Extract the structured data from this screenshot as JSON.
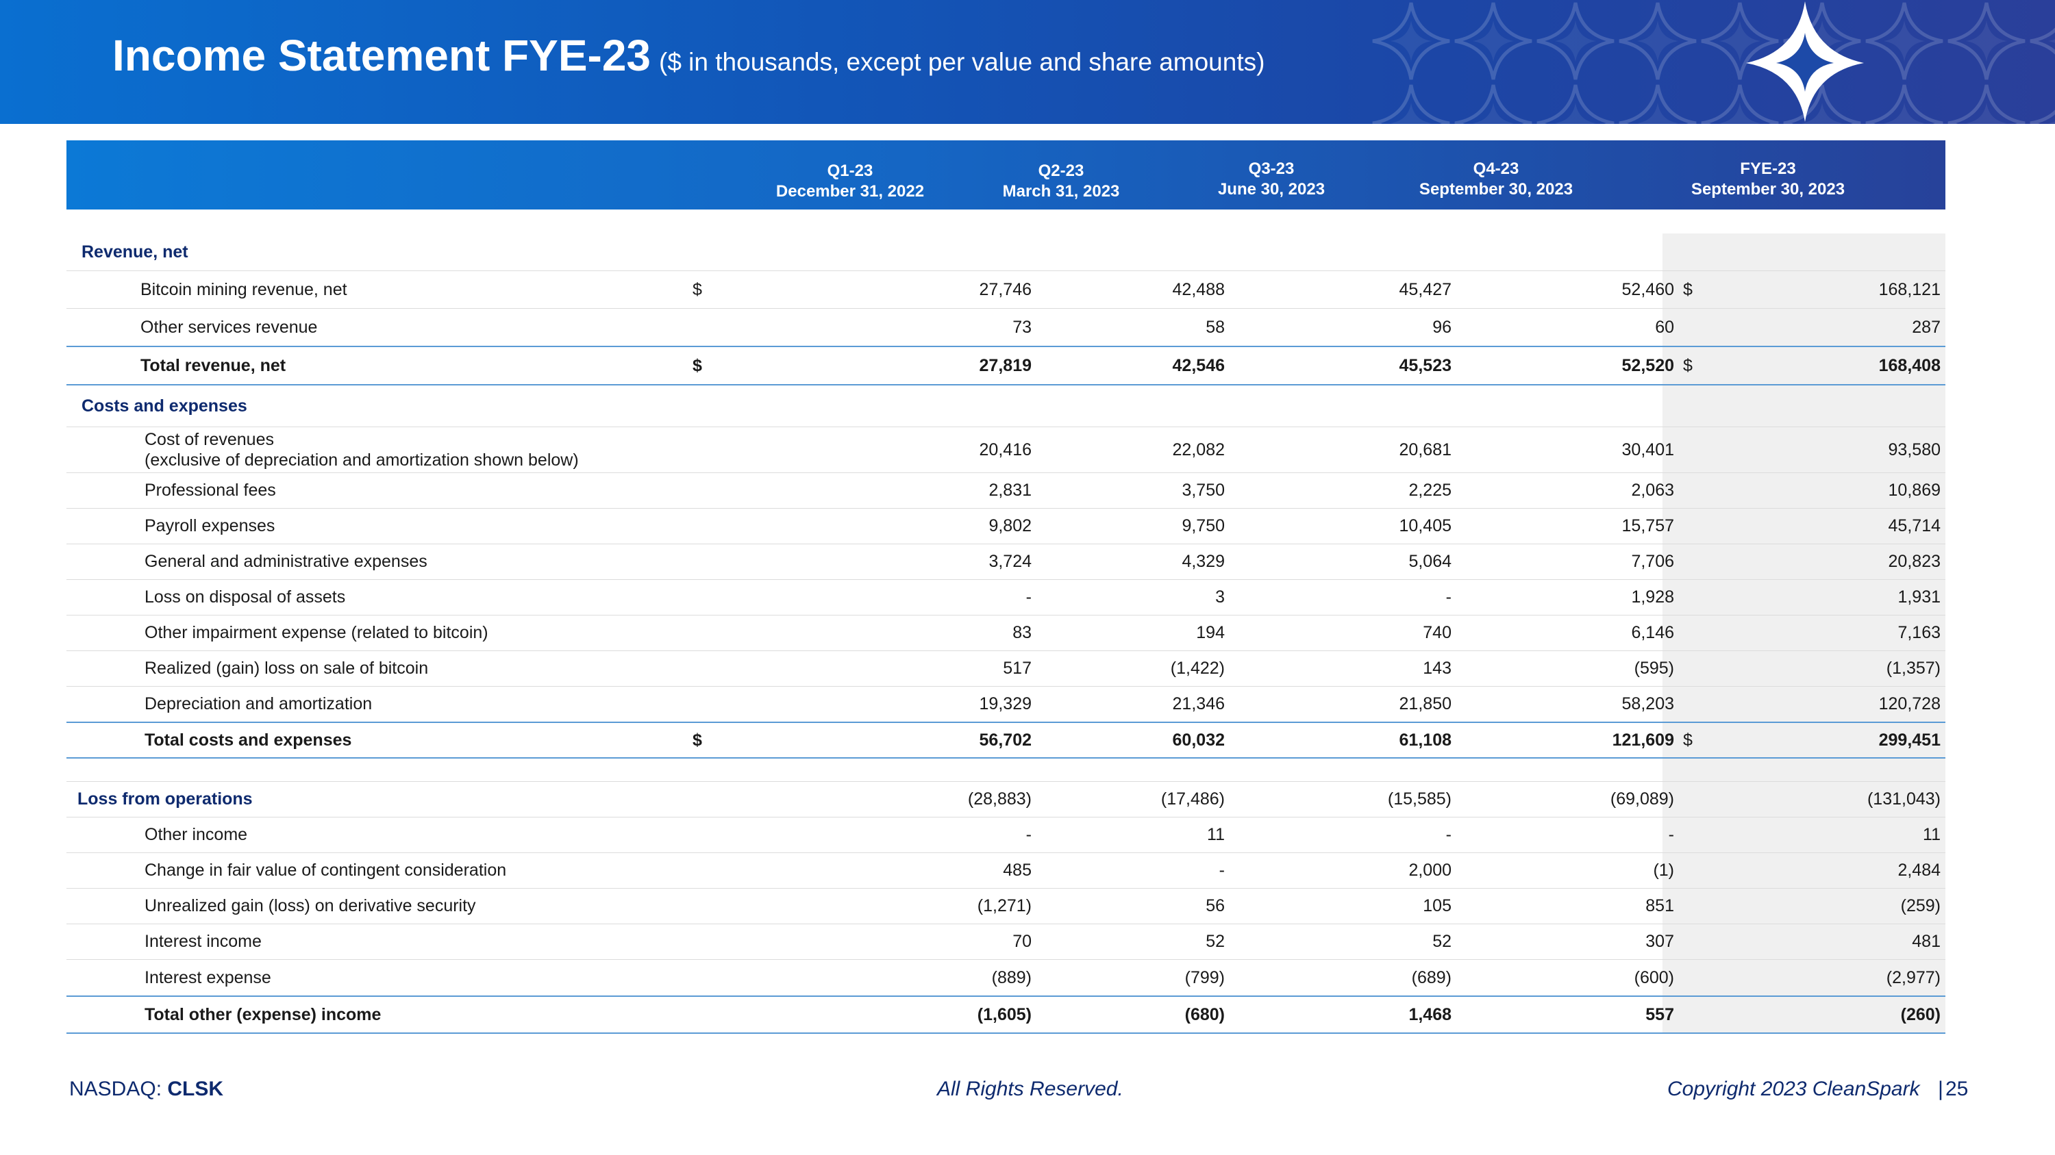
{
  "header": {
    "title": "Income Statement FYE-23",
    "subtitle": "($ in thousands, except per value and share amounts)",
    "logo_icon": "cleanspark-star-logo-icon"
  },
  "columns": [
    {
      "period": "Q1-23",
      "date": "December 31, 2022"
    },
    {
      "period": "Q2-23",
      "date": "March 31, 2023"
    },
    {
      "period": "Q3-23",
      "date": "June 30, 2023"
    },
    {
      "period": "Q4-23",
      "date": "September 30, 2023"
    },
    {
      "period": "FYE-23",
      "date": "September 30, 2023"
    }
  ],
  "rows": {
    "revenue_header": "Revenue, net",
    "bitcoin": {
      "label": "Bitcoin mining revenue, net",
      "d1": "$",
      "d5": "$",
      "v": [
        "27,746",
        "42,488",
        "45,427",
        "52,460",
        "168,121"
      ]
    },
    "other_services": {
      "label": "Other services revenue",
      "v": [
        "73",
        "58",
        "96",
        "60",
        "287"
      ]
    },
    "total_revenue": {
      "label": "Total revenue, net",
      "d1": "$",
      "d5": "$",
      "v": [
        "27,819",
        "42,546",
        "45,523",
        "52,520",
        "168,408"
      ]
    },
    "costs_header": "Costs and expenses",
    "cost_of_revenues": {
      "label": "Cost of revenues",
      "label2": "(exclusive of depreciation and amortization shown below)",
      "v": [
        "20,416",
        "22,082",
        "20,681",
        "30,401",
        "93,580"
      ]
    },
    "professional_fees": {
      "label": "Professional fees",
      "v": [
        "2,831",
        "3,750",
        "2,225",
        "2,063",
        "10,869"
      ]
    },
    "payroll": {
      "label": "Payroll expenses",
      "v": [
        "9,802",
        "9,750",
        "10,405",
        "15,757",
        "45,714"
      ]
    },
    "general_admin": {
      "label": "General and administrative expenses",
      "v": [
        "3,724",
        "4,329",
        "5,064",
        "7,706",
        "20,823"
      ]
    },
    "loss_disposal": {
      "label": "Loss on disposal of assets",
      "v": [
        "-",
        "3",
        "-",
        "1,928",
        "1,931"
      ]
    },
    "impairment": {
      "label": "Other impairment expense (related to bitcoin)",
      "v": [
        "83",
        "194",
        "740",
        "6,146",
        "7,163"
      ]
    },
    "realized": {
      "label": "Realized (gain) loss on sale of bitcoin",
      "v": [
        "517",
        "(1,422)",
        "143",
        "(595)",
        "(1,357)"
      ]
    },
    "depreciation": {
      "label": "Depreciation and amortization",
      "v": [
        "19,329",
        "21,346",
        "21,850",
        "58,203",
        "120,728"
      ]
    },
    "total_costs": {
      "label": "Total costs and expenses",
      "d1": "$",
      "d5": "$",
      "v": [
        "56,702",
        "60,032",
        "61,108",
        "121,609",
        "299,451"
      ]
    },
    "loss_operations": {
      "label": "Loss from operations",
      "v": [
        "(28,883)",
        "(17,486)",
        "(15,585)",
        "(69,089)",
        "(131,043)"
      ]
    },
    "other_income": {
      "label": "Other income",
      "v": [
        "-",
        "11",
        "-",
        "-",
        "11"
      ]
    },
    "contingent": {
      "label": "Change in fair value of contingent consideration",
      "v": [
        "485",
        "-",
        "2,000",
        "(1)",
        "2,484"
      ]
    },
    "unrealized": {
      "label": "Unrealized gain (loss) on derivative security",
      "v": [
        "(1,271)",
        "56",
        "105",
        "851",
        "(259)"
      ]
    },
    "interest_income": {
      "label": "Interest income",
      "v": [
        "70",
        "52",
        "52",
        "307",
        "481"
      ]
    },
    "interest_expense": {
      "label": "Interest expense",
      "v": [
        "(889)",
        "(799)",
        "(689)",
        "(600)",
        "(2,977)"
      ]
    },
    "total_other": {
      "label": "Total other (expense) income",
      "v": [
        "(1,605)",
        "(680)",
        "1,468",
        "557",
        "(260)"
      ]
    }
  },
  "footer": {
    "exchange": "NASDAQ: ",
    "ticker": "CLSK",
    "rights": "All Rights Reserved.",
    "copyright": "Copyright 2023 CleanSpark",
    "separator": "|",
    "page": "25"
  }
}
